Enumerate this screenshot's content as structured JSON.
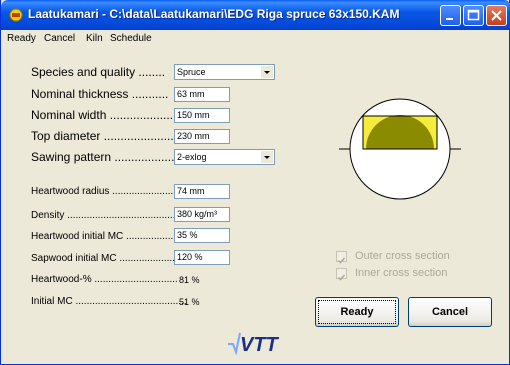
{
  "window": {
    "title": "Laatukamari - C:\\data\\Laatukamari\\EDG Riga spruce 63x150.KAM"
  },
  "menu": [
    "Ready",
    "Cancel",
    "Kiln",
    "Schedule"
  ],
  "form": {
    "species_label": "Species and quality ........",
    "species_value": "Spruce",
    "thickness_label": "Nominal thickness ...........",
    "thickness_value": "63 mm",
    "width_label": "Nominal width .....................",
    "width_value": "150 mm",
    "diameter_label": "Top diameter .......................",
    "diameter_value": "230 mm",
    "pattern_label": "Sawing pattern ...................",
    "pattern_value": "2-exlog",
    "hw_radius_label": "Heartwood radius .......................",
    "hw_radius_value": "74 mm",
    "density_label": "Density ..............................................",
    "density_value": "380 kg/m³",
    "hw_mc_label": "Heartwood initial MC .................",
    "hw_mc_value": "35 %",
    "sw_mc_label": "Sapwood initial MC .....................",
    "sw_mc_value": "120 %",
    "hw_pct_label": "Heartwood-% ..............................",
    "hw_pct_value": "81 %",
    "init_mc_label": "Initial MC ........................................",
    "init_mc_value": "51 %"
  },
  "options": {
    "outer_label": "Outer cross section",
    "inner_label": "Inner cross section"
  },
  "buttons": {
    "ready": "Ready",
    "cancel": "Cancel"
  },
  "logo_text": "VTT",
  "colors": {
    "heartwood": "#8b8b00",
    "sapwood": "#f5ec3c"
  }
}
